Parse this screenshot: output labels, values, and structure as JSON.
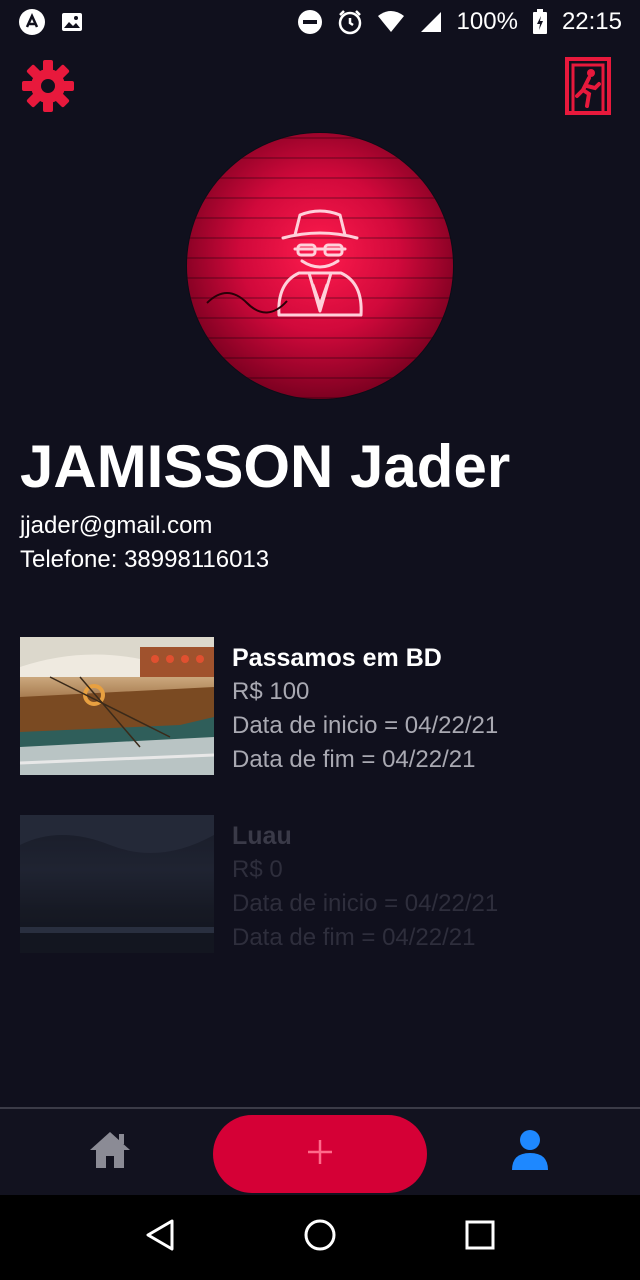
{
  "status_bar": {
    "battery": "100%",
    "time": "22:15"
  },
  "profile": {
    "name": "JAMISSON Jader",
    "email": "jjader@gmail.com",
    "phone": "Telefone: 38998116013"
  },
  "events": [
    {
      "title": "Passamos em BD",
      "price": "R$ 100",
      "start": "Data de inicio = 04/22/21",
      "end": "Data de fim = 04/22/21"
    },
    {
      "title": "Luau",
      "price": "R$ 0",
      "start": "Data de inicio = 04/22/21",
      "end": "Data de fim = 04/22/21"
    }
  ],
  "colors": {
    "background": "#10101d",
    "accent": "#d50036",
    "active_nav": "#1e88ff"
  },
  "icons": {
    "settings": "gear-icon",
    "logout": "exit-door-icon",
    "home": "home-icon",
    "add": "plus-icon",
    "profile": "user-icon"
  }
}
